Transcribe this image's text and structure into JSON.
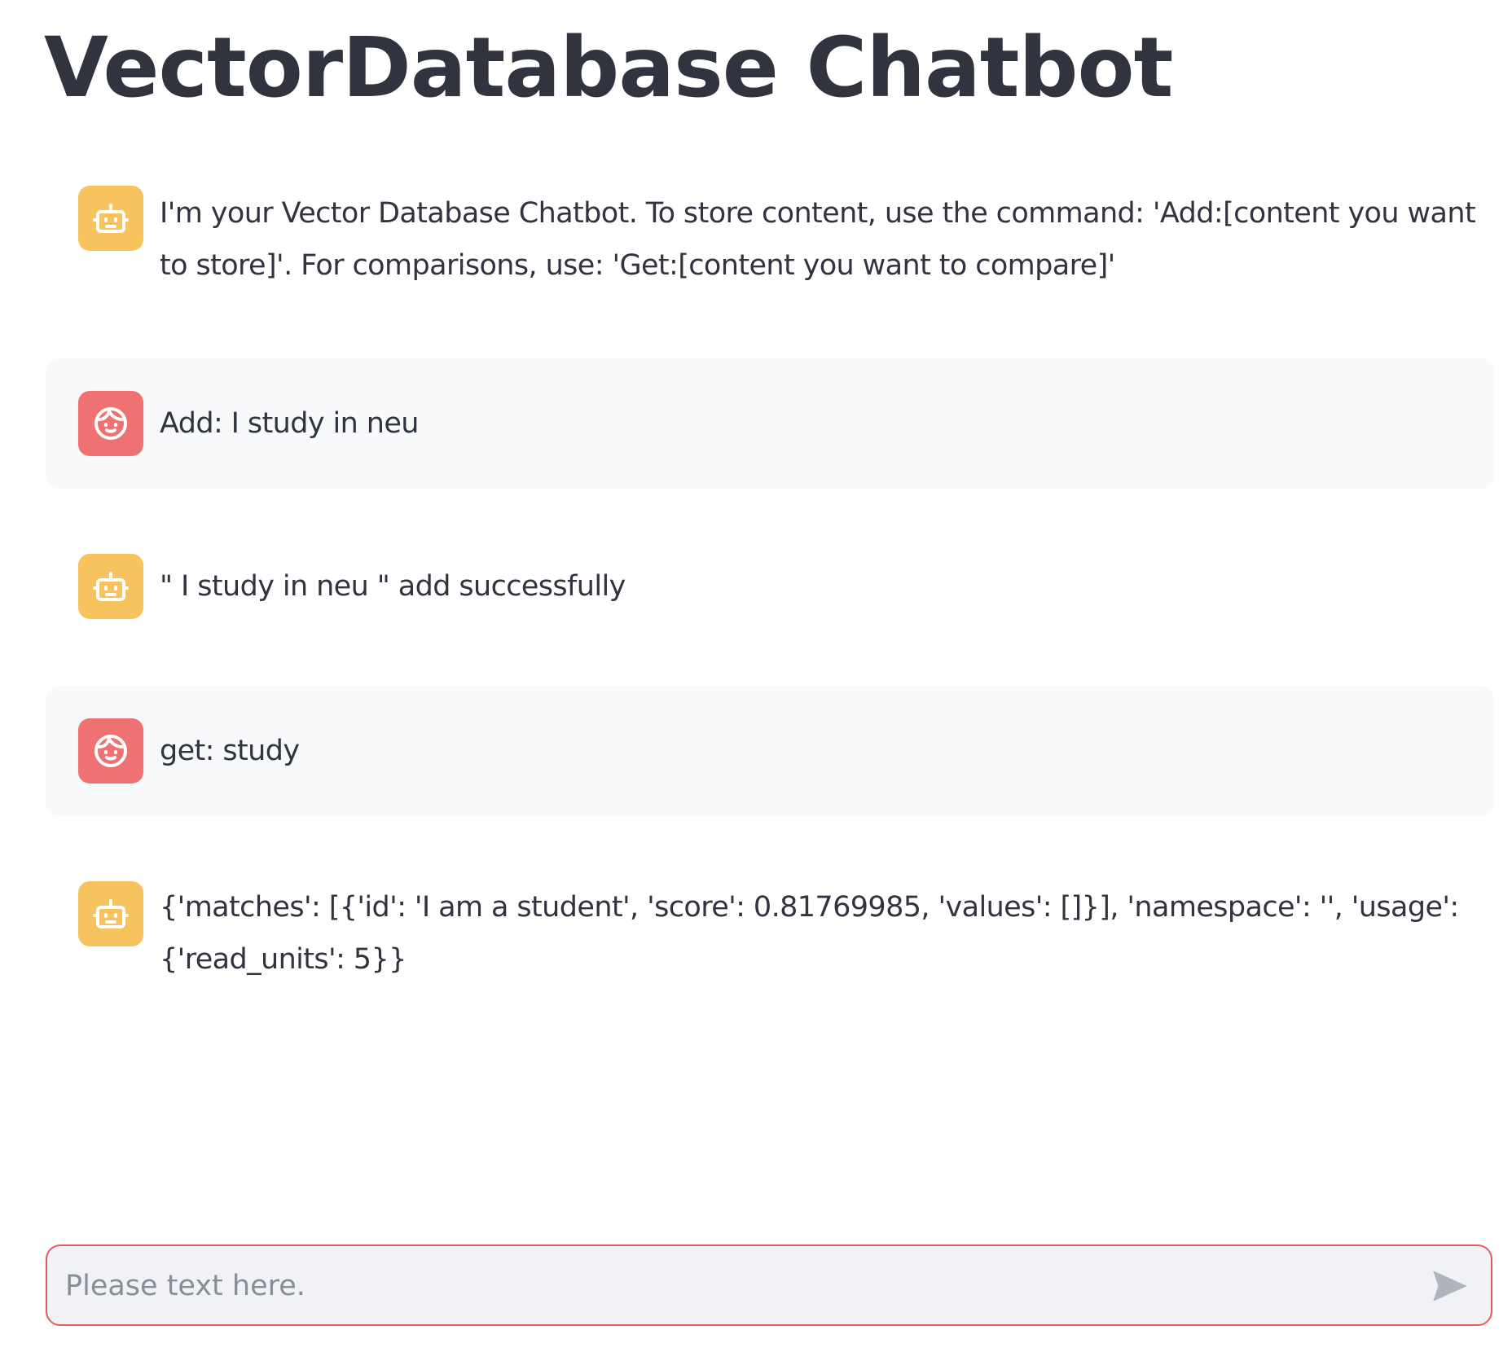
{
  "app": {
    "title": "VectorDatabase Chatbot"
  },
  "messages": [
    {
      "role": "assistant",
      "avatar_icon": "robot-icon",
      "text": "I'm your Vector Database Chatbot. To store content, use the command: 'Add:[content you want to store]'. For comparisons, use: 'Get:[content you want to compare]'"
    },
    {
      "role": "user",
      "avatar_icon": "user-face-icon",
      "text": "Add: I study in neu"
    },
    {
      "role": "assistant",
      "avatar_icon": "robot-icon",
      "text": "\" I study in neu \" add successfully"
    },
    {
      "role": "user",
      "avatar_icon": "user-face-icon",
      "text": "get: study"
    },
    {
      "role": "assistant",
      "avatar_icon": "robot-icon",
      "text": "{'matches': [{'id': 'I am a student', 'score': 0.81769985, 'values': []}], 'namespace': '', 'usage': {'read_units': 5}}"
    }
  ],
  "chat_input": {
    "value": "",
    "placeholder": "Please text here.",
    "send_icon": "send-icon"
  },
  "colors": {
    "bot_avatar": "#f7c35f",
    "user_avatar": "#ef7273",
    "input_border": "#e8595d",
    "user_message_bg": "#f8f9fb",
    "text": "#31333f"
  }
}
